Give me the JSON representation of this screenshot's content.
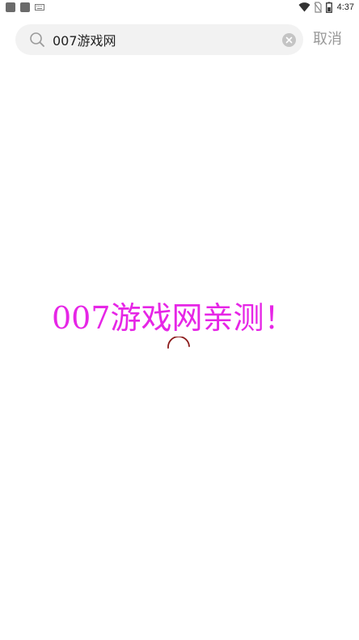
{
  "status_bar": {
    "time": "4:37",
    "icons": [
      "app-icon",
      "app-icon",
      "keyboard-icon",
      "wifi-icon",
      "no-sim-icon",
      "battery-icon"
    ]
  },
  "search": {
    "query": "007游戏网",
    "cancel_label": "取消"
  },
  "content": {
    "overlay_text": "007游戏网亲测！"
  },
  "colors": {
    "overlay_text": "#e626e6",
    "spinner": "#8b1a1a",
    "search_bg": "#f2f2f2",
    "cancel": "#999999"
  }
}
